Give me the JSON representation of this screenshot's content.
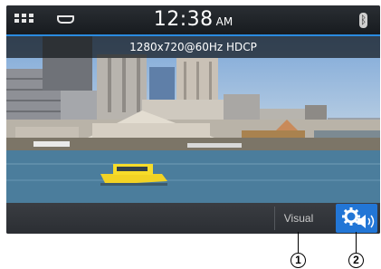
{
  "status_bar": {
    "time": "12:38",
    "ampm": "AM",
    "icons": [
      "apps-grid-icon",
      "hdmi-icon",
      "bluetooth-icon"
    ]
  },
  "video": {
    "resolution_text": "1280x720@60Hz HDCP"
  },
  "bottom_bar": {
    "visual_label": "Visual",
    "settings_icons": [
      "gear-icon",
      "speaker-icon"
    ]
  },
  "callouts": [
    "1",
    "2"
  ],
  "colors": {
    "accent": "#2276d6",
    "status_underline": "#2a8be0",
    "bar_background": "#2b2e33"
  }
}
